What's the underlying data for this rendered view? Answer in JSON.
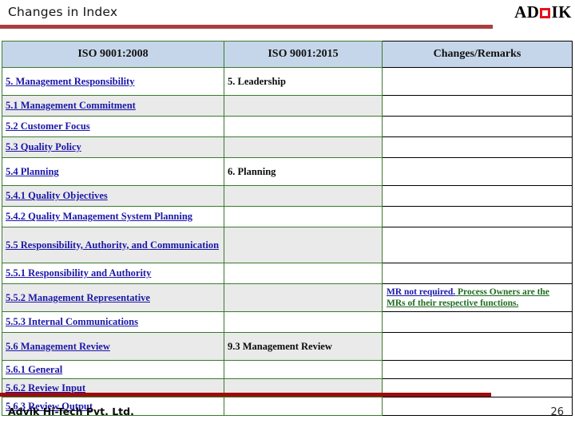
{
  "header": {
    "title": "Changes in Index",
    "logo": {
      "text_before": "AD",
      "mark": "red-square-icon",
      "text_after": "IK",
      "accent_color": "#e8111b"
    },
    "rule_color": "#a93f3f"
  },
  "table": {
    "columns": [
      "ISO 9001:2008",
      "ISO 9001:2015",
      "Changes/Remarks"
    ],
    "border_color_main": "#3a7a2e",
    "border_color_remarks": "#000000",
    "header_bg": "#c6d6ea",
    "stripe_bg": "#eaeaea",
    "old_text_color": "#1b17a8",
    "remark_blue_color": "#1b17a8",
    "remark_green_color": "#1f6b1f",
    "rows": [
      {
        "old": "5. Management Responsibility",
        "new": "5. Leadership",
        "remarks_blue": "",
        "remarks_green": ""
      },
      {
        "old": "5.1 Management Commitment",
        "new": "",
        "remarks_blue": "",
        "remarks_green": ""
      },
      {
        "old": "5.2 Customer Focus",
        "new": "",
        "remarks_blue": "",
        "remarks_green": ""
      },
      {
        "old": "5.3 Quality Policy",
        "new": "",
        "remarks_blue": "",
        "remarks_green": ""
      },
      {
        "old": "5.4 Planning",
        "new": "6. Planning",
        "remarks_blue": "",
        "remarks_green": ""
      },
      {
        "old": "5.4.1 Quality Objectives",
        "new": "",
        "remarks_blue": "",
        "remarks_green": ""
      },
      {
        "old": "5.4.2 Quality Management System Planning",
        "new": "",
        "remarks_blue": "",
        "remarks_green": ""
      },
      {
        "old": "5.5 Responsibility, Authority, and Communication",
        "new": "",
        "remarks_blue": "",
        "remarks_green": ""
      },
      {
        "old": "5.5.1 Responsibility and Authority",
        "new": "",
        "remarks_blue": "",
        "remarks_green": ""
      },
      {
        "old": "5.5.2 Management Representative",
        "new": "",
        "remarks_blue": "MR not required.",
        "remarks_green": " Process Owners are the MRs of their respective functions."
      },
      {
        "old": "5.5.3 Internal Communications",
        "new": "",
        "remarks_blue": "",
        "remarks_green": ""
      },
      {
        "old": "5.6 Management Review",
        "new": "9.3 Management Review",
        "remarks_blue": "",
        "remarks_green": ""
      },
      {
        "old": "5.6.1 General",
        "new": "",
        "remarks_blue": "",
        "remarks_green": ""
      },
      {
        "old": "5.6.2 Review Input",
        "new": "",
        "remarks_blue": "",
        "remarks_green": ""
      },
      {
        "old": "5.6.3 Review Output",
        "new": "",
        "remarks_blue": "",
        "remarks_green": ""
      }
    ]
  },
  "footer": {
    "company": "Advik Hi-Tech Pvt. Ltd.",
    "page_number": "26",
    "rule_color": "#9d0c0c"
  }
}
